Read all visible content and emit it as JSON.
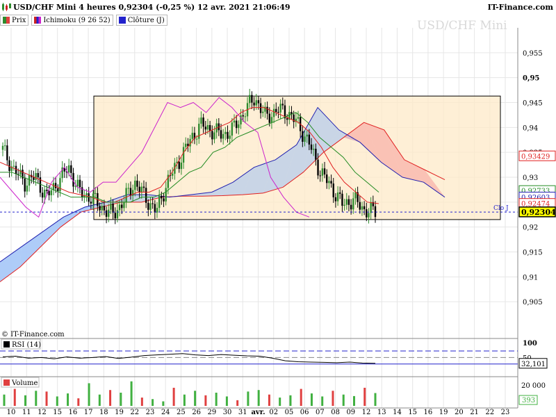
{
  "header": {
    "title": "USD/CHF Mini 4 heures 0,92304 (-0,25 %) 12 avr. 2021 21:06:49",
    "site": "IT-Finance.com",
    "watermark": "USD/CHF Mini"
  },
  "legend": [
    {
      "label": "Prix",
      "color": "#2e8b2e"
    },
    {
      "label": "Ichimoku (9 26 52)",
      "color": "#cc2222"
    },
    {
      "label": "Clôture (J)",
      "color": "#2222cc"
    }
  ],
  "colors": {
    "up": "#2e8b2e",
    "down": "#000000",
    "tenkan": "#e02020",
    "kijun": "#228b22",
    "chikou": "#cc22cc",
    "span_a": "#e02020",
    "span_b": "#2020b0",
    "cloud_bull": "#a8c8f8",
    "cloud_bear": "#f8a8a8",
    "box_fill": "#fde9c8",
    "rsi": "#000000",
    "vol_up": "#40b040",
    "vol_down": "#e04040"
  },
  "chart_data": [
    {
      "type": "line",
      "subtype": "candlestick-ichimoku",
      "title": "USD/CHF Mini",
      "ylim": [
        0.9,
        0.96
      ],
      "y_ticks": [
        "0,955",
        "0,95",
        "0,945",
        "0,94",
        "0,935",
        "0,93",
        "0,925",
        "0,92",
        "0,915",
        "0,91",
        "0,905"
      ],
      "x_ticks": [
        "10",
        "11",
        "12",
        "15",
        "16",
        "17",
        "18",
        "19",
        "22",
        "23",
        "24",
        "25",
        "26",
        "29",
        "30",
        "31",
        "avr.",
        "02",
        "05",
        "06",
        "07",
        "08",
        "09",
        "12",
        "13",
        "14",
        "15",
        "16",
        "19",
        "20",
        "21",
        "22",
        "23"
      ],
      "price_labels": [
        {
          "text": "0,93429",
          "value": 0.93429,
          "color": "#e02020"
        },
        {
          "text": "0,92733",
          "value": 0.92733,
          "color": "#228b22"
        },
        {
          "text": "0,92603",
          "value": 0.92603,
          "color": "#2020b0"
        },
        {
          "text": "0,92474",
          "value": 0.92474,
          "color": "#e02020"
        },
        {
          "text": "0,92304",
          "value": 0.92304,
          "color": "#000000"
        }
      ],
      "clotj_label": "Clo J",
      "clotj_value": 0.923,
      "highlight_range": {
        "y_low": 0.9215,
        "y_high": 0.9463
      },
      "ohlc_anchor_closes": [
        0.9355,
        0.9315,
        0.929,
        0.93,
        0.926,
        0.929,
        0.932,
        0.927,
        0.926,
        0.924,
        0.9225,
        0.925,
        0.929,
        0.926,
        0.923,
        0.929,
        0.933,
        0.937,
        0.9405,
        0.9395,
        0.9385,
        0.9395,
        0.943,
        0.946,
        0.942,
        0.9435,
        0.943,
        0.9405,
        0.9365,
        0.931,
        0.928,
        0.9245,
        0.9255,
        0.9235,
        0.923
      ],
      "tenkan": [
        0.933,
        0.932,
        0.931,
        0.93,
        0.929,
        0.928,
        0.927,
        0.9265,
        0.926,
        0.925,
        0.925,
        0.926,
        0.927,
        0.927,
        0.928,
        0.931,
        0.935,
        0.938,
        0.939,
        0.94,
        0.941,
        0.943,
        0.944,
        0.944,
        0.943,
        0.942,
        0.941,
        0.939,
        0.936,
        0.932,
        0.929,
        0.927,
        0.925,
        0.9247
      ],
      "kijun": [
        0.931,
        0.931,
        0.93,
        0.929,
        0.928,
        0.927,
        0.926,
        0.926,
        0.926,
        0.925,
        0.925,
        0.925,
        0.926,
        0.926,
        0.927,
        0.929,
        0.931,
        0.932,
        0.935,
        0.936,
        0.938,
        0.939,
        0.94,
        0.941,
        0.942,
        0.943,
        0.941,
        0.938,
        0.936,
        0.934,
        0.931,
        0.929,
        0.927
      ],
      "chikou": [
        0.93,
        0.927,
        0.924,
        0.922,
        0.929,
        0.932,
        0.928,
        0.927,
        0.929,
        0.929,
        0.932,
        0.935,
        0.94,
        0.945,
        0.944,
        0.945,
        0.943,
        0.946,
        0.944,
        0.941,
        0.939,
        0.93,
        0.926,
        0.923,
        0.922
      ],
      "span_a": [
        0.909,
        0.912,
        0.916,
        0.92,
        0.923,
        0.924,
        0.925,
        0.925,
        0.926,
        0.9262,
        0.9262,
        0.9263,
        0.9265,
        0.9268,
        0.928,
        0.931,
        0.935,
        0.938,
        0.941,
        0.9395,
        0.9335,
        0.9315,
        0.9295
      ],
      "span_b": [
        0.913,
        0.916,
        0.919,
        0.922,
        0.924,
        0.925,
        0.9265,
        0.9265,
        0.926,
        0.9265,
        0.927,
        0.929,
        0.932,
        0.9335,
        0.9365,
        0.944,
        0.9395,
        0.937,
        0.933,
        0.93,
        0.929,
        0.926
      ]
    },
    {
      "type": "line",
      "title": "RSI (14)",
      "ylim": [
        0,
        100
      ],
      "levels": [
        100,
        50
      ],
      "y_ticks": [
        "100",
        "50"
      ],
      "last_value_text": "32,101",
      "values": [
        52,
        54,
        48,
        50,
        46,
        52,
        48,
        50,
        53,
        47,
        51,
        56,
        58,
        60,
        62,
        58,
        56,
        59,
        57,
        55,
        54,
        48,
        40,
        37,
        36,
        35,
        34,
        36,
        33,
        32.1
      ]
    },
    {
      "type": "bar",
      "title": "Volume",
      "y_ticks": [
        "20 000"
      ],
      "last_value_text": "393",
      "series": [
        {
          "values": [
            30,
            45,
            28,
            40,
            38,
            25,
            33,
            20,
            60,
            30,
            42,
            35,
            65,
            22,
            18,
            12,
            48,
            30,
            40,
            28,
            35,
            25,
            15,
            38,
            42,
            30,
            22,
            28,
            45,
            33,
            25,
            40,
            30,
            26,
            48,
            34
          ]
        }
      ]
    }
  ],
  "footer": {
    "copyright": "© IT-Finance.com"
  },
  "panels": {
    "rsi_title": "RSI (14)",
    "volume_title": "Volume"
  }
}
